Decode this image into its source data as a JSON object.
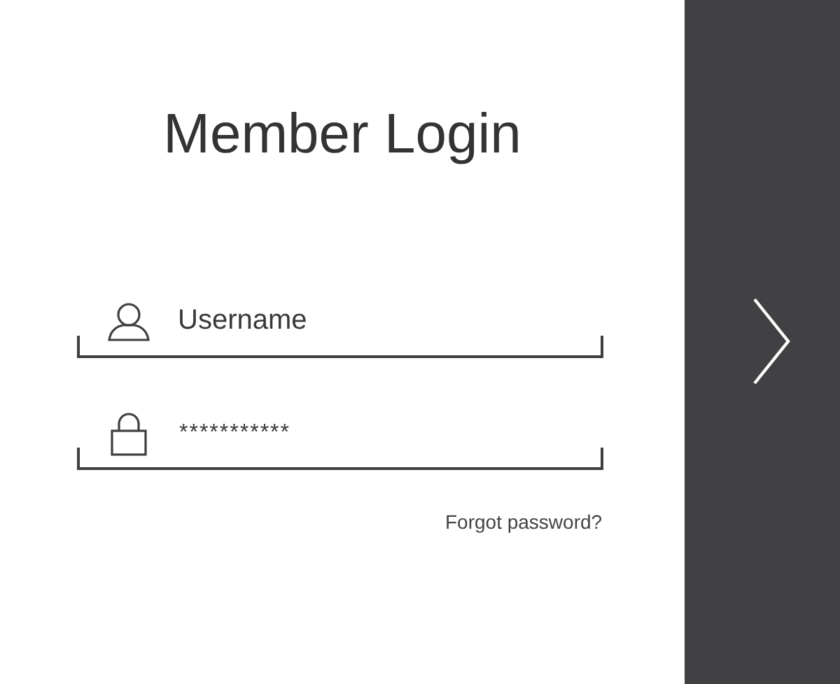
{
  "title": "Member Login",
  "username": {
    "placeholder": "Username"
  },
  "password": {
    "value": "***********"
  },
  "forgot_link": "Forgot password?"
}
